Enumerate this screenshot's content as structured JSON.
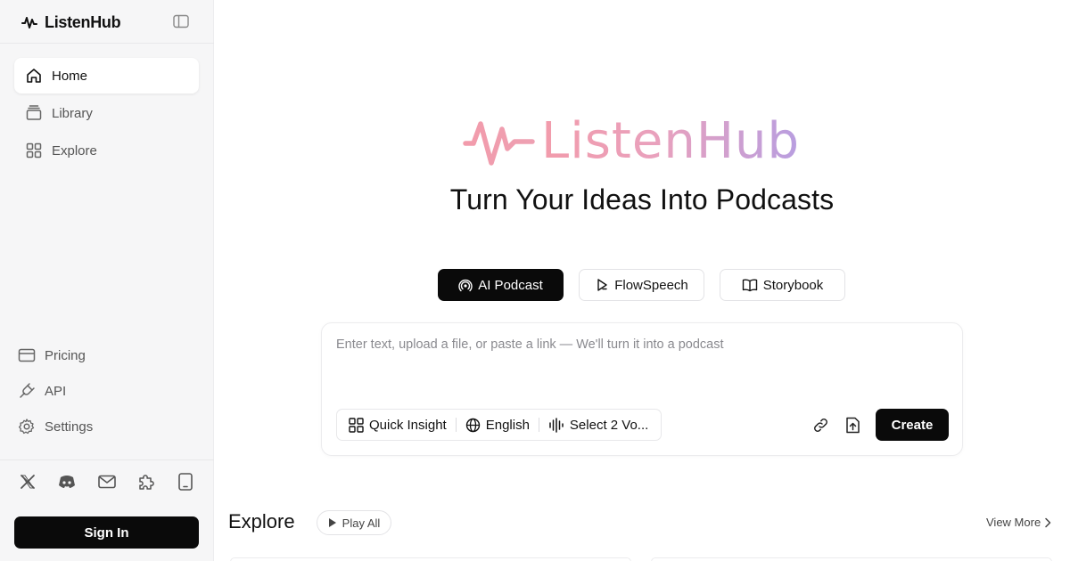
{
  "sidebar": {
    "brand": "ListenHub",
    "nav": [
      {
        "label": "Home",
        "icon": "home-icon",
        "active": true
      },
      {
        "label": "Library",
        "icon": "library-icon",
        "active": false
      },
      {
        "label": "Explore",
        "icon": "grid-icon",
        "active": false
      }
    ],
    "secondary": [
      {
        "label": "Pricing",
        "icon": "card-icon"
      },
      {
        "label": "API",
        "icon": "plug-icon"
      },
      {
        "label": "Settings",
        "icon": "gear-icon"
      }
    ],
    "socials": [
      "x-icon",
      "discord-icon",
      "mail-icon",
      "puzzle-icon",
      "tablet-icon"
    ],
    "sign_in": "Sign In"
  },
  "hero": {
    "logo_text": "ListenHub",
    "headline": "Turn Your Ideas Into Podcasts"
  },
  "modes": [
    {
      "label": "AI Podcast",
      "icon": "podcast-icon",
      "active": true
    },
    {
      "label": "FlowSpeech",
      "icon": "flowspeech-icon",
      "active": false
    },
    {
      "label": "Storybook",
      "icon": "book-icon",
      "active": false
    }
  ],
  "composer": {
    "placeholder": "Enter text, upload a file, or paste a link — We'll turn it into a podcast",
    "options": [
      {
        "label": "Quick Insight",
        "icon": "grid-icon"
      },
      {
        "label": "English",
        "icon": "globe-icon"
      },
      {
        "label": "Select 2 Vo...",
        "icon": "waveform-icon"
      }
    ],
    "create": "Create"
  },
  "explore": {
    "title": "Explore",
    "play_all": "Play All",
    "view_more": "View More"
  },
  "colors": {
    "primary": "#0a0a0a",
    "sidebar_bg": "#f6f6f7",
    "logo_gradient_start": "#f29bab",
    "logo_gradient_end": "#b89ee0"
  }
}
